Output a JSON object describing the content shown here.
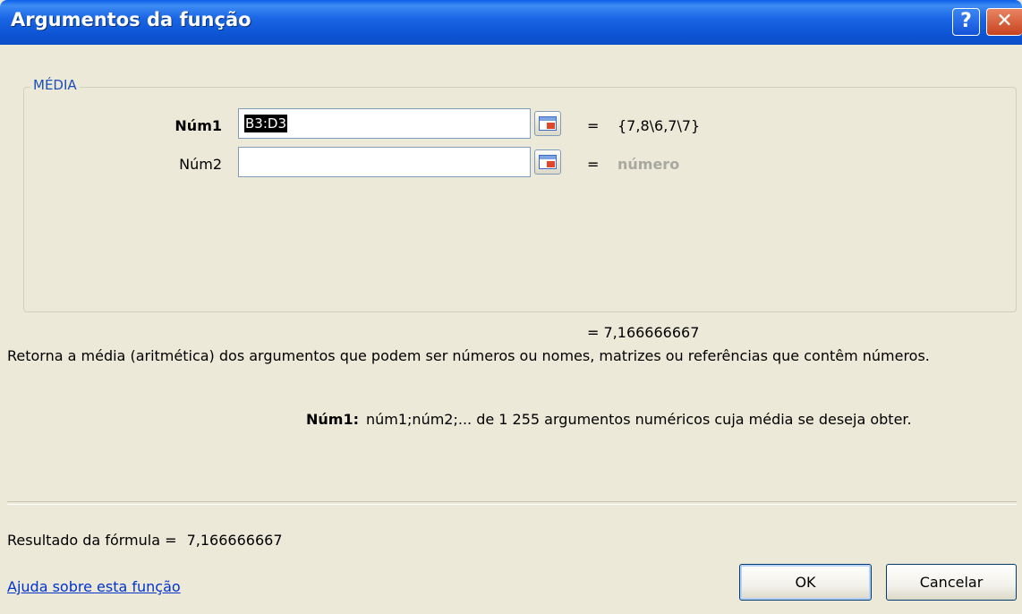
{
  "window": {
    "title": "Argumentos da função"
  },
  "titlebar": {
    "help_label": "?",
    "close_label": "✕"
  },
  "group": {
    "function_name": "MÉDIA"
  },
  "args": [
    {
      "label": "Núm1",
      "value": "B3:D3",
      "result": "{7,8\\6,7\\7}"
    },
    {
      "label": "Núm2",
      "value": "",
      "result": "número"
    }
  ],
  "equals": "=",
  "function_result": "= 7,166666667",
  "description": "Retorna a média (aritmética) dos argumentos que podem ser números ou nomes, matrizes ou referências que contêm números.",
  "arg_help": {
    "name": "Núm1:",
    "text": "núm1;núm2;... de 1 255 argumentos numéricos cuja média se deseja obter."
  },
  "formula_result": {
    "label": "Resultado da fórmula =",
    "value": "7,166666667"
  },
  "help_link": "Ajuda sobre esta função",
  "buttons": {
    "ok": "OK",
    "cancel": "Cancelar"
  }
}
